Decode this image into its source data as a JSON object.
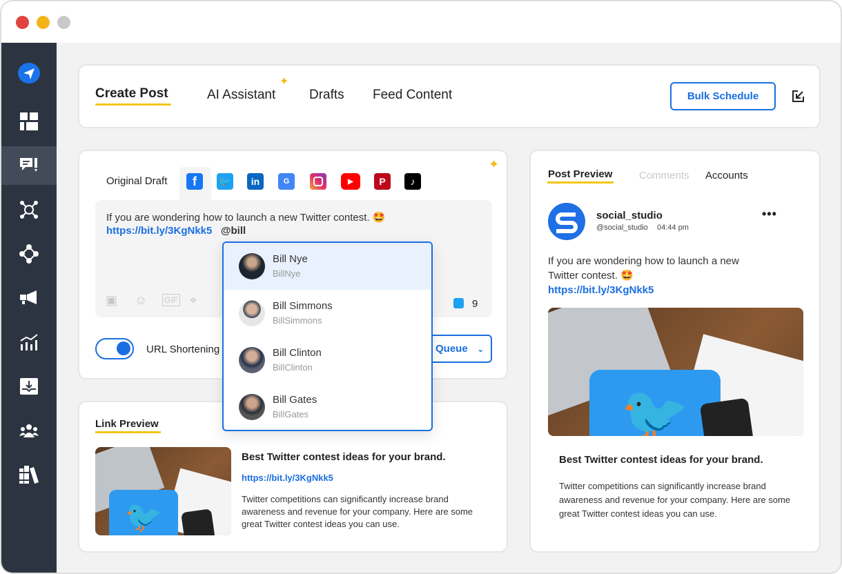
{
  "window": {
    "controls": [
      "close",
      "minimize",
      "maximize"
    ]
  },
  "sidebar": {
    "items": [
      {
        "icon": "paper-plane-icon"
      },
      {
        "icon": "dashboard-icon"
      },
      {
        "icon": "compose-icon",
        "active": true
      },
      {
        "icon": "network-icon"
      },
      {
        "icon": "workflow-icon"
      },
      {
        "icon": "megaphone-icon"
      },
      {
        "icon": "analytics-icon"
      },
      {
        "icon": "inbox-icon"
      },
      {
        "icon": "team-icon"
      },
      {
        "icon": "library-icon"
      }
    ]
  },
  "header": {
    "tabs": [
      {
        "label": "Create Post",
        "active": true
      },
      {
        "label": "AI Assistant"
      },
      {
        "label": "Drafts"
      },
      {
        "label": "Feed Content"
      }
    ],
    "bulk_schedule": "Bulk Schedule"
  },
  "composer": {
    "original_draft": "Original Draft",
    "platforms": [
      "facebook",
      "twitter",
      "linkedin",
      "google-business",
      "instagram",
      "youtube",
      "pinterest",
      "tiktok"
    ],
    "text": "If you are wondering how to launch a new Twitter contest.",
    "emoji": "🤩",
    "link": "https://bit.ly/3KgNkk5",
    "mention": "@bill",
    "char_count": "9",
    "url_shortening": "URL Shortening",
    "url_shortening_on": true,
    "queue_label": "Queue"
  },
  "mentions": [
    {
      "name": "Bill Nye",
      "handle": "BillNye",
      "highlighted": true
    },
    {
      "name": "Bill Simmons",
      "handle": "BillSimmons"
    },
    {
      "name": "Bill Clinton",
      "handle": "BillClinton"
    },
    {
      "name": "Bill Gates",
      "handle": "BillGates"
    }
  ],
  "link_preview": {
    "title": "Link Preview",
    "headline": "Best Twitter contest ideas for your brand.",
    "url": "https://bit.ly/3KgNkk5",
    "description": "Twitter competitions can significantly increase brand awareness and revenue for your company. Here are some great Twitter contest ideas you can use."
  },
  "post_preview": {
    "tabs": [
      {
        "label": "Post Preview",
        "active": true
      },
      {
        "label": "Comments",
        "disabled": true
      },
      {
        "label": "Accounts"
      }
    ],
    "account_name": "social_studio",
    "account_handle": "@social_studio",
    "time": "04:44 pm",
    "text": "If you are wondering how to launch a new Twitter contest.",
    "emoji": "🤩",
    "link": "https://bit.ly/3KgNkk5",
    "headline": "Best Twitter contest ideas for your brand.",
    "description": "Twitter competitions can significantly increase brand awareness and revenue for your company. Here are some great Twitter contest ideas you can use."
  },
  "colors": {
    "accent": "#1a6ee0",
    "underline": "#f5c518",
    "sidebar": "#2d3441"
  }
}
